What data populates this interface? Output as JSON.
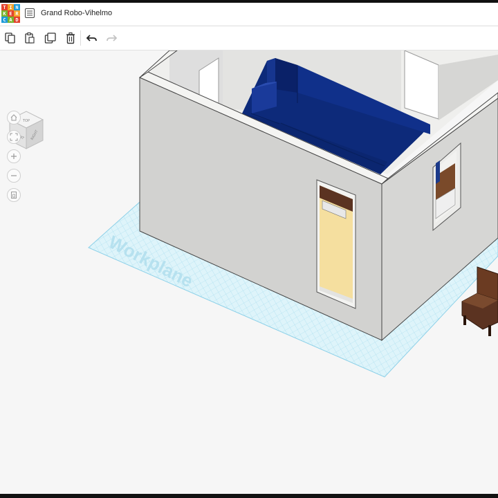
{
  "app": {
    "name": "Tinkercad"
  },
  "logo": {
    "letters": [
      "T",
      "I",
      "N",
      "K",
      "E",
      "R",
      "C",
      "A",
      "D"
    ],
    "colors": [
      "#e2412c",
      "#f3a12b",
      "#1e9bd7",
      "#79b32d",
      "#e2412c",
      "#f3a12b",
      "#1e9bd7",
      "#79b32d",
      "#e2412c"
    ]
  },
  "document": {
    "title": "Grand Robo-Vihelmo"
  },
  "toolbar": {
    "copy_icon": "copy-icon",
    "paste_icon": "paste-icon",
    "duplicate_icon": "duplicate-icon",
    "delete_icon": "trash-icon",
    "undo_icon": "undo-icon",
    "redo_icon": "redo-icon",
    "redo_enabled": false
  },
  "viewcube": {
    "top": "TOP",
    "front": "FRONT",
    "right": "RIGHT"
  },
  "nav": {
    "home_icon": "home-icon",
    "fit_icon": "fit-view-icon",
    "zoom_in_icon": "plus-icon",
    "zoom_out_icon": "minus-icon",
    "ortho_icon": "perspective-icon"
  },
  "workplane": {
    "label": "Workplane"
  },
  "colors": {
    "wall": "#d2d2d0",
    "wall_top": "#f4f4f2",
    "couch": "#0e2a77",
    "grid": "#bfe6f3",
    "wood": "#5b3321",
    "door_glow": "#f5df9f"
  }
}
